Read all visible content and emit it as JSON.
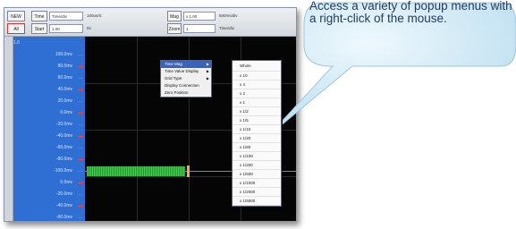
{
  "toolbar": {
    "buttons": [
      "NEW",
      "Time",
      "Mag",
      "All",
      "Start",
      "Zoom"
    ],
    "fields": [
      "Time/div",
      "1.00",
      "x 1.00",
      "1"
    ],
    "texts": [
      "100us/S",
      "0s",
      "500ms/div",
      "Time/div"
    ]
  },
  "scale": {
    "top_label": "1.0",
    "labels": [
      "100.0mv",
      "80.0mv",
      "60.0mv",
      "40.0mv",
      "20.0mv",
      "0.0mv",
      "-20.0mv",
      "-40.0mv",
      "-60.0mv",
      "-80.0mv",
      "-100.0mv",
      "0.0mv",
      "-20.0mv",
      "-40.0mv",
      "-60.0mv",
      "-80.0mv"
    ]
  },
  "popup_menu": {
    "items": [
      {
        "label": "Time Mag",
        "has_submenu": true,
        "active": true
      },
      {
        "label": "Time Value Display",
        "has_submenu": true,
        "active": false
      },
      {
        "label": "Grid Type",
        "has_submenu": true,
        "active": false
      },
      {
        "label": "Display Connection",
        "has_submenu": false,
        "active": false
      },
      {
        "label": "Zero Position",
        "has_submenu": false,
        "active": false
      }
    ]
  },
  "submenu": {
    "items": [
      "Whole",
      "x 10",
      "x 4",
      "x 2",
      "x 1",
      "x 1/2",
      "x 1/5",
      "x 1/10",
      "x 1/20",
      "x 1/50",
      "x 1/100",
      "x 1/200",
      "x 1/500",
      "x 1/1000",
      "x 1/2000",
      "x 1/5000"
    ]
  },
  "callout": {
    "text": "Access a variety of popup menus with a right-click of the mouse."
  },
  "colors": {
    "scale_panel": "#2f6fd4",
    "plot_bg": "#050505",
    "signal": "#3fd24a",
    "callout_fill": "#cfe8f6",
    "callout_text": "#1f3b58"
  }
}
